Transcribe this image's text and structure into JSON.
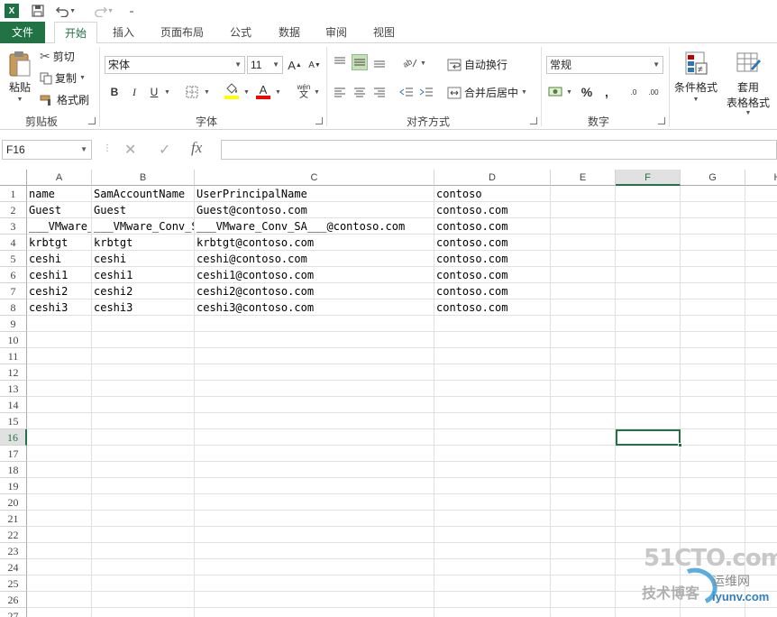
{
  "app": {
    "logo_text": "X",
    "qat_icons": [
      "excel-logo-icon",
      "save-icon",
      "undo-icon",
      "redo-icon",
      "customize-icon"
    ]
  },
  "tabs": [
    {
      "label": "文件",
      "kind": "file"
    },
    {
      "label": "开始",
      "kind": "active"
    },
    {
      "label": "插入"
    },
    {
      "label": "页面布局"
    },
    {
      "label": "公式"
    },
    {
      "label": "数据"
    },
    {
      "label": "审阅"
    },
    {
      "label": "视图"
    }
  ],
  "ribbon": {
    "clipboard": {
      "paste": "粘贴",
      "cut": "剪切",
      "copy": "复制",
      "format_painter": "格式刷",
      "group_label": "剪贴板"
    },
    "font": {
      "font_name": "宋体",
      "font_size": "11",
      "grow": "A",
      "shrink": "A",
      "bold": "B",
      "italic": "I",
      "underline": "U",
      "font_color_glyph": "A",
      "phonetic": "wén",
      "group_label": "字体"
    },
    "alignment": {
      "wrap_text": "自动换行",
      "merge_center": "合并后居中",
      "group_label": "对齐方式"
    },
    "number": {
      "format": "常规",
      "percent": "%",
      "comma": ",",
      "inc_decimal": ".0",
      "dec_decimal": ".00",
      "group_label": "数字"
    },
    "styles": {
      "conditional_format": "条件格式",
      "format_table_1": "套用",
      "format_table_2": "表格格式"
    }
  },
  "formula_bar": {
    "name_box": "F16",
    "fx": "fx",
    "formula": ""
  },
  "sheet": {
    "columns": [
      "A",
      "B",
      "C",
      "D",
      "E",
      "F",
      "G",
      "H"
    ],
    "selected_column": "F",
    "row_numbers": [
      "1",
      "2",
      "3",
      "4",
      "5",
      "6",
      "7",
      "8",
      "9",
      "10",
      "11",
      "12",
      "13",
      "14",
      "15",
      "16",
      "17",
      "18",
      "19",
      "20",
      "21",
      "22",
      "23",
      "24",
      "25",
      "26",
      "27"
    ],
    "selected_row": "16",
    "rows": [
      [
        "name",
        "SamAccountName",
        "UserPrincipalName",
        "contoso"
      ],
      [
        "Guest",
        "Guest",
        "Guest@contoso.com",
        "contoso.com"
      ],
      [
        "___VMware_Conv_SA___",
        "___VMware_Conv_SA___",
        "___VMware_Conv_SA___@contoso.com",
        "contoso.com"
      ],
      [
        "krbtgt",
        "krbtgt",
        "krbtgt@contoso.com",
        "contoso.com"
      ],
      [
        "ceshi",
        "ceshi",
        "ceshi@contoso.com",
        "contoso.com"
      ],
      [
        "ceshi1",
        "ceshi1",
        "ceshi1@contoso.com",
        "contoso.com"
      ],
      [
        "ceshi2",
        "ceshi2",
        "ceshi2@contoso.com",
        "contoso.com"
      ],
      [
        "ceshi3",
        "ceshi3",
        "ceshi3@contoso.com",
        "contoso.com"
      ]
    ]
  },
  "watermark": {
    "brand": "51CTO.com",
    "line1": "技术博客",
    "line2": "运维网",
    "url": "iyunv.com"
  }
}
